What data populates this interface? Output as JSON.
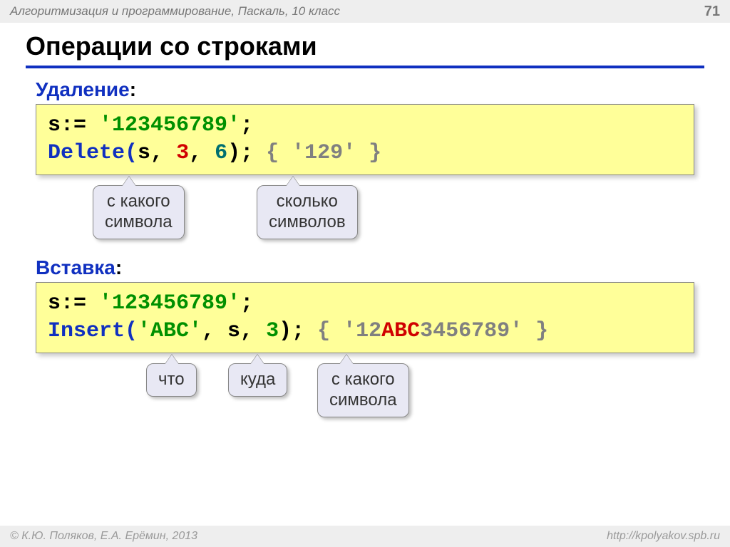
{
  "header": {
    "course": "Алгоритмизация и программирование, Паскаль, 10 класс",
    "page": "71"
  },
  "title": "Операции со строками",
  "delete_section": {
    "label": "Удаление",
    "colon": ":",
    "code": {
      "l1": {
        "a": "s:=",
        "b": "'123456789'",
        "c": ";"
      },
      "l2": {
        "a": "Delete(",
        "b": "s,",
        "c": "3",
        "d": ",",
        "e": "6",
        "f": ");",
        "g": "{ '129' }"
      }
    },
    "callouts": {
      "c1": "с какого\nсимвола",
      "c2": "сколько\nсимволов"
    }
  },
  "insert_section": {
    "label": "Вставка",
    "colon": ":",
    "code": {
      "l1": {
        "a": "s:=",
        "b": "'123456789'",
        "c": ";"
      },
      "l2": {
        "a": "Insert(",
        "b": "'ABC'",
        "c": ", s,",
        "d": "3",
        "e": ");",
        "comment": {
          "a": "{ '12",
          "b": "ABC",
          "c": "3456789' }"
        }
      }
    },
    "callouts": {
      "c1": "что",
      "c2": "куда",
      "c3": "с какого\nсимвола"
    }
  },
  "footer": {
    "copyright": "© К.Ю. Поляков, Е.А. Ерёмин, 2013",
    "url": "http://kpolyakov.spb.ru"
  }
}
